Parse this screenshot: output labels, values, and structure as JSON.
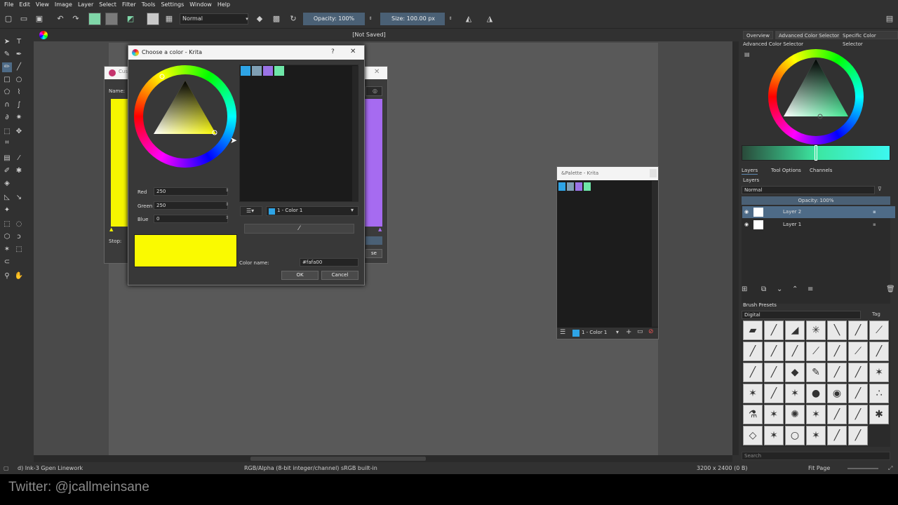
{
  "menu": [
    "File",
    "Edit",
    "View",
    "Image",
    "Layer",
    "Select",
    "Filter",
    "Tools",
    "Settings",
    "Window",
    "Help"
  ],
  "toolbar": {
    "blend_mode": "Normal",
    "opacity_label": "Opacity: 100%",
    "size_label": "Size: 100.00 px"
  },
  "window_title": "[Not Saved]",
  "color_dialog": {
    "title": "Choose a color - Krita",
    "help": "?",
    "close": "✕",
    "red_label": "Red",
    "red_value": "250",
    "green_label": "Green",
    "green_value": "250",
    "blue_label": "Blue",
    "blue_value": "0",
    "palette_entry": "1 - Color 1",
    "color_name_label": "Color name:",
    "color_name_value": "#fafa00",
    "ok": "OK",
    "cancel": "Cancel",
    "preview_color": "#fafa00",
    "recent_colors": [
      "#2ea4e6",
      "#7f9fb4",
      "#9a73e6",
      "#6ee6a8"
    ]
  },
  "gradient_dialog": {
    "title": "Cus",
    "name_label": "Name:",
    "stop_label": "Stop:",
    "close_fragment": "se",
    "left_color": "#f5f500",
    "right_color": "#a66bf0"
  },
  "palette_window": {
    "title": "&Palette - Krita",
    "entry": "1 - Color 1",
    "colors": [
      "#2ea4e6",
      "#7f9fb4",
      "#9a73e6",
      "#6ee6a8"
    ]
  },
  "docker": {
    "tabs": [
      "Overview",
      "Advanced Color Selector",
      "Specific Color Selector"
    ],
    "selector_title": "Advanced Color Selector",
    "layer_tabs": [
      "Layers",
      "Tool Options",
      "Channels"
    ],
    "layers_title": "Layers",
    "layer_blend": "Normal",
    "layer_opacity": "Opacity:  100%",
    "layers": [
      {
        "name": "Layer 2",
        "selected": true
      },
      {
        "name": "Layer 1",
        "selected": false
      }
    ],
    "brush_presets_title": "Brush Presets",
    "brush_tag": "Digital",
    "tag_label": "Tag",
    "search_placeholder": "Search"
  },
  "status": {
    "brush": "d) Ink-3 Gpen Linework",
    "color_space": "RGB/Alpha (8-bit integer/channel)  sRGB built-in",
    "dimensions": "3200 x 2400 (0 B)",
    "zoom": "Fit Page"
  },
  "overlay_text": "Twitter: @jcallmeinsane",
  "colors": {
    "accent": "#4a6075",
    "selection": "#4e6b87",
    "fg_color": "#7fd6a8",
    "bg_color": "#7a7a7a"
  }
}
